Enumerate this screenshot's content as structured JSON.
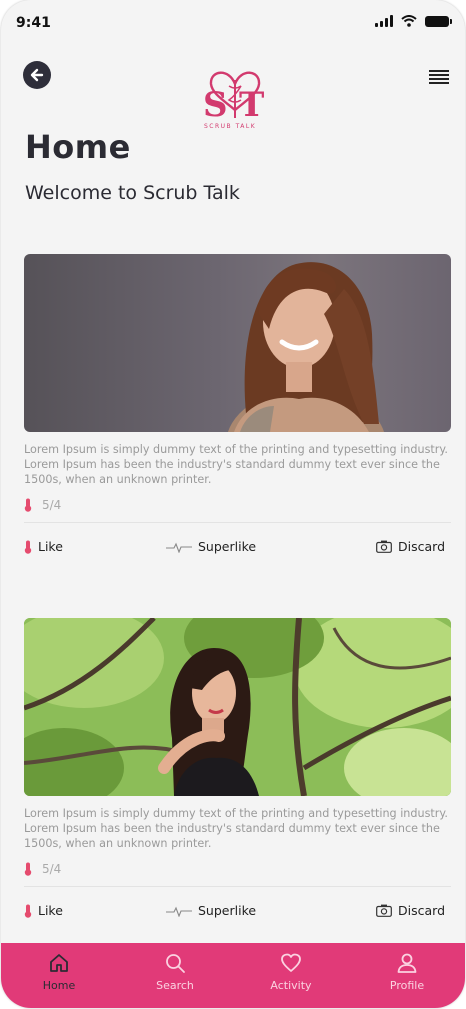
{
  "status_bar": {
    "time": "9:41"
  },
  "header": {
    "logo_text": "ST",
    "logo_tagline": "SCRUB TALK",
    "title": "Home",
    "subtitle": "Welcome to Scrub Talk"
  },
  "posts": [
    {
      "description": "Lorem Ipsum is simply dummy text of the printing and typesetting industry. Lorem Ipsum has been the industry's standard dummy text ever since the 1500s, when an unknown printer.",
      "rating": "5/4",
      "like_label": "Like",
      "superlike_label": "Superlike",
      "discard_label": "Discard"
    },
    {
      "description": "Lorem Ipsum is simply dummy text of the printing and typesetting industry. Lorem Ipsum has been the industry's standard dummy text ever since the 1500s, when an unknown printer.",
      "rating": "5/4",
      "like_label": "Like",
      "superlike_label": "Superlike",
      "discard_label": "Discard"
    }
  ],
  "bottom_nav": {
    "items": [
      {
        "label": "Home",
        "icon": "home-icon",
        "active": true
      },
      {
        "label": "Search",
        "icon": "search-icon",
        "active": false
      },
      {
        "label": "Activity",
        "icon": "heart-icon",
        "active": false
      },
      {
        "label": "Profile",
        "icon": "user-icon",
        "active": false
      }
    ]
  },
  "colors": {
    "accent": "#e13a78",
    "text_dark": "#2b2b33",
    "background": "#f4f4f4"
  }
}
